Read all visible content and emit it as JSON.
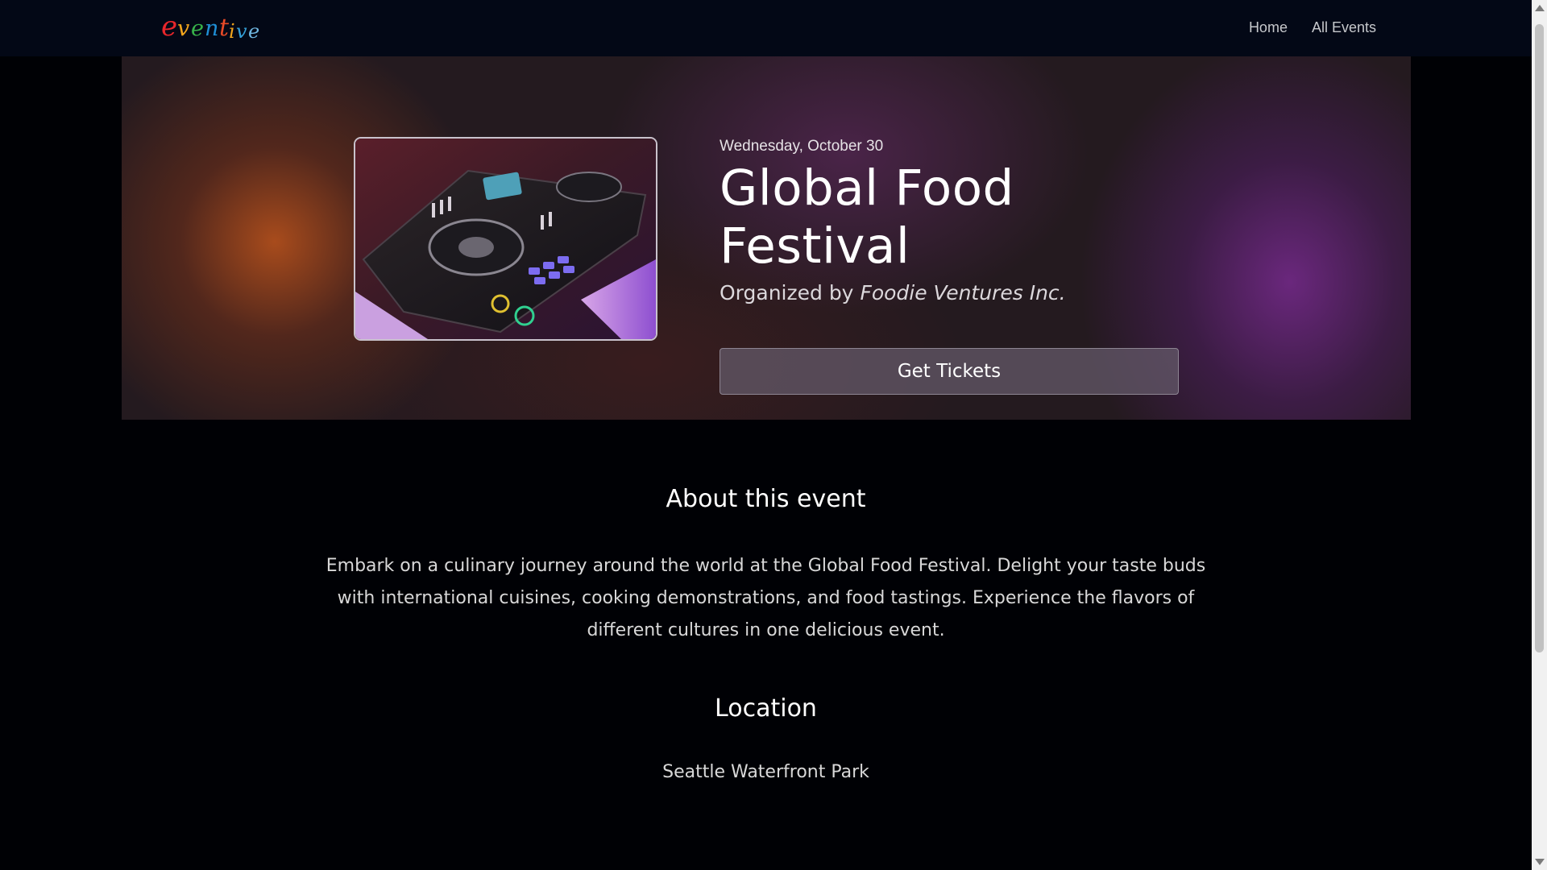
{
  "navbar": {
    "logo_text": "eventive",
    "links": [
      "Home",
      "All Events"
    ]
  },
  "hero": {
    "date": "Wednesday, October 30",
    "title": "Global Food Festival",
    "organized_by_label": "Organized by",
    "organizer": "Foodie Ventures Inc.",
    "ticket_button_label": "Get Tickets"
  },
  "about": {
    "title": "About this event",
    "description": "Embark on a culinary journey around the world at the Global Food Festival. Delight your taste buds with international cuisines, cooking demonstrations, and food tastings. Experience the flavors of different cultures in one delicious event."
  },
  "location": {
    "title": "Location",
    "value": "Seattle Waterfront Park"
  },
  "colors": {
    "page_bg": "#000105",
    "navbar_bg": "#030816",
    "button_bg": "#645a69"
  }
}
